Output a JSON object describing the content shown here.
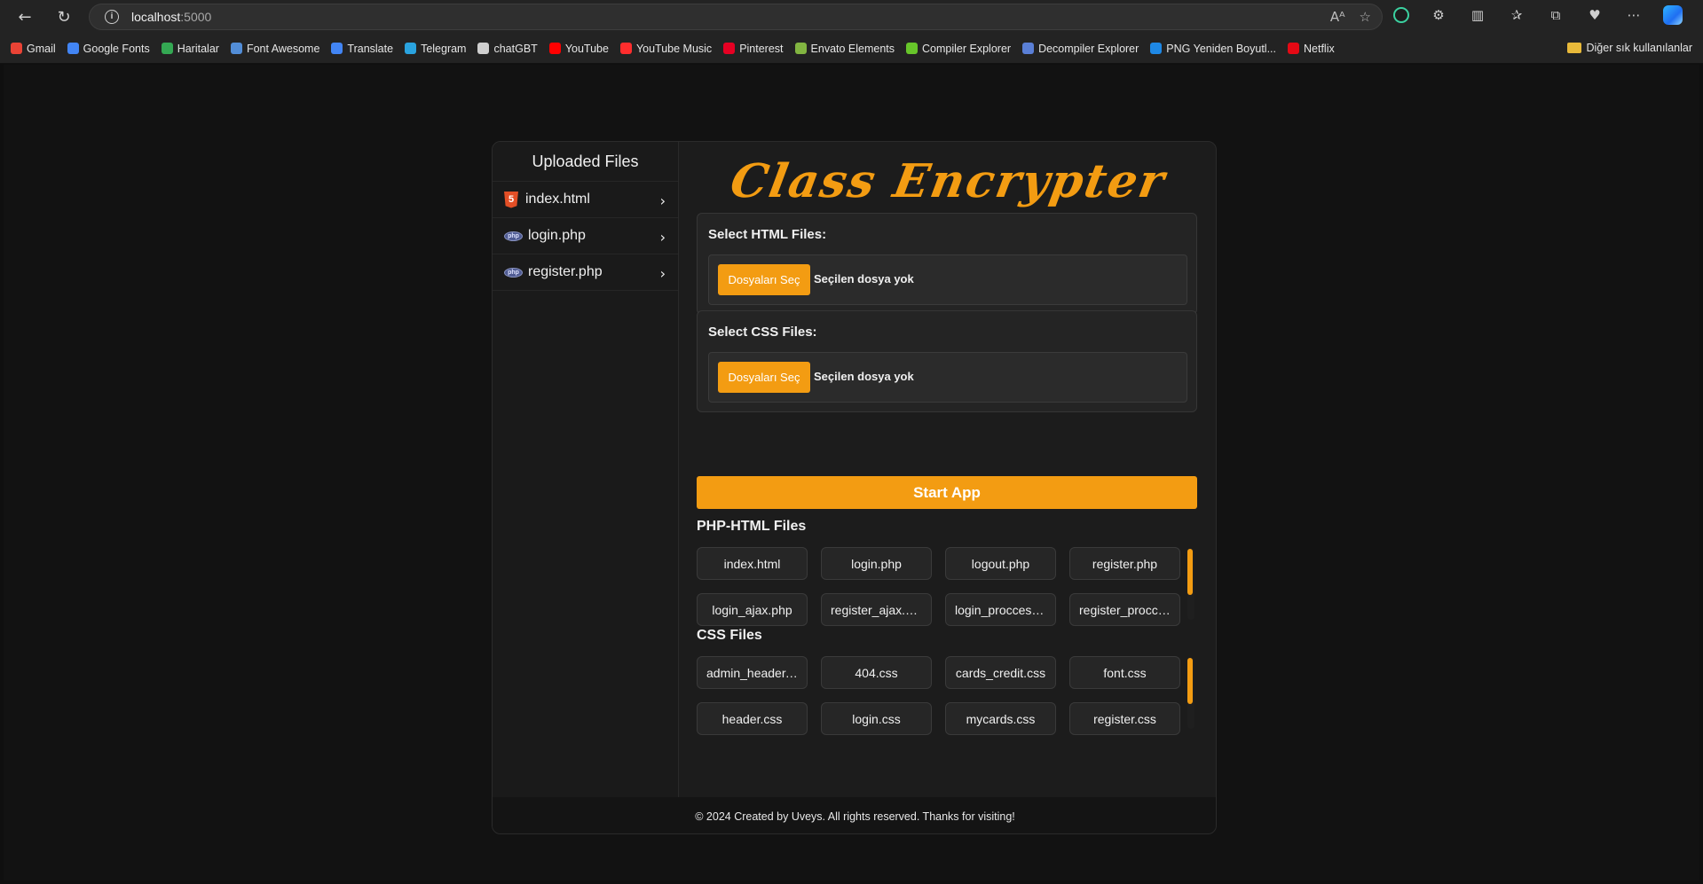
{
  "browser": {
    "url_host": "localhost",
    "url_port": ":5000",
    "bookmarks": [
      {
        "label": "Gmail",
        "color": "#ea4335"
      },
      {
        "label": "Google Fonts",
        "color": "#4285f4"
      },
      {
        "label": "Haritalar",
        "color": "#34a853"
      },
      {
        "label": "Font Awesome",
        "color": "#528dd7"
      },
      {
        "label": "Translate",
        "color": "#4285f4"
      },
      {
        "label": "Telegram",
        "color": "#2aa3df"
      },
      {
        "label": "chatGBT",
        "color": "#cfcfcf"
      },
      {
        "label": "YouTube",
        "color": "#ff0000"
      },
      {
        "label": "YouTube Music",
        "color": "#ff2d2d"
      },
      {
        "label": "Pinterest",
        "color": "#e60023"
      },
      {
        "label": "Envato Elements",
        "color": "#82b541"
      },
      {
        "label": "Compiler Explorer",
        "color": "#67c52a"
      },
      {
        "label": "Decompiler Explorer",
        "color": "#5a7fd6"
      },
      {
        "label": "PNG Yeniden Boyutl...",
        "color": "#1e88e5"
      },
      {
        "label": "Netflix",
        "color": "#e50914"
      }
    ],
    "other_bookmarks": "Diğer sık kullanılanlar"
  },
  "sidebar": {
    "title": "Uploaded Files",
    "files": [
      {
        "name": "index.html",
        "icon": "html5-icon"
      },
      {
        "name": "login.php",
        "icon": "php-icon"
      },
      {
        "name": "register.php",
        "icon": "php-icon"
      }
    ]
  },
  "main": {
    "logo": "Class Encrypter",
    "html_select": {
      "label": "Select HTML Files:",
      "button": "Dosyaları Seç",
      "status": "Seçilen dosya yok"
    },
    "css_select": {
      "label": "Select CSS Files:",
      "button": "Dosyaları Seç",
      "status": "Seçilen dosya yok"
    },
    "start_button": "Start App",
    "php_html_title": "PHP-HTML Files",
    "php_html_files": [
      "index.html",
      "login.php",
      "logout.php",
      "register.php",
      "login_ajax.php",
      "register_ajax.php",
      "login_procces.php",
      "register_procces.php"
    ],
    "css_title": "CSS Files",
    "css_files": [
      "admin_header.css",
      "404.css",
      "cards_credit.css",
      "font.css",
      "header.css",
      "login.css",
      "mycards.css",
      "register.css"
    ]
  },
  "footer": {
    "text": "© 2024 Created by Uveys. All rights reserved. Thanks for visiting!"
  },
  "colors": {
    "accent": "#f39c12"
  }
}
